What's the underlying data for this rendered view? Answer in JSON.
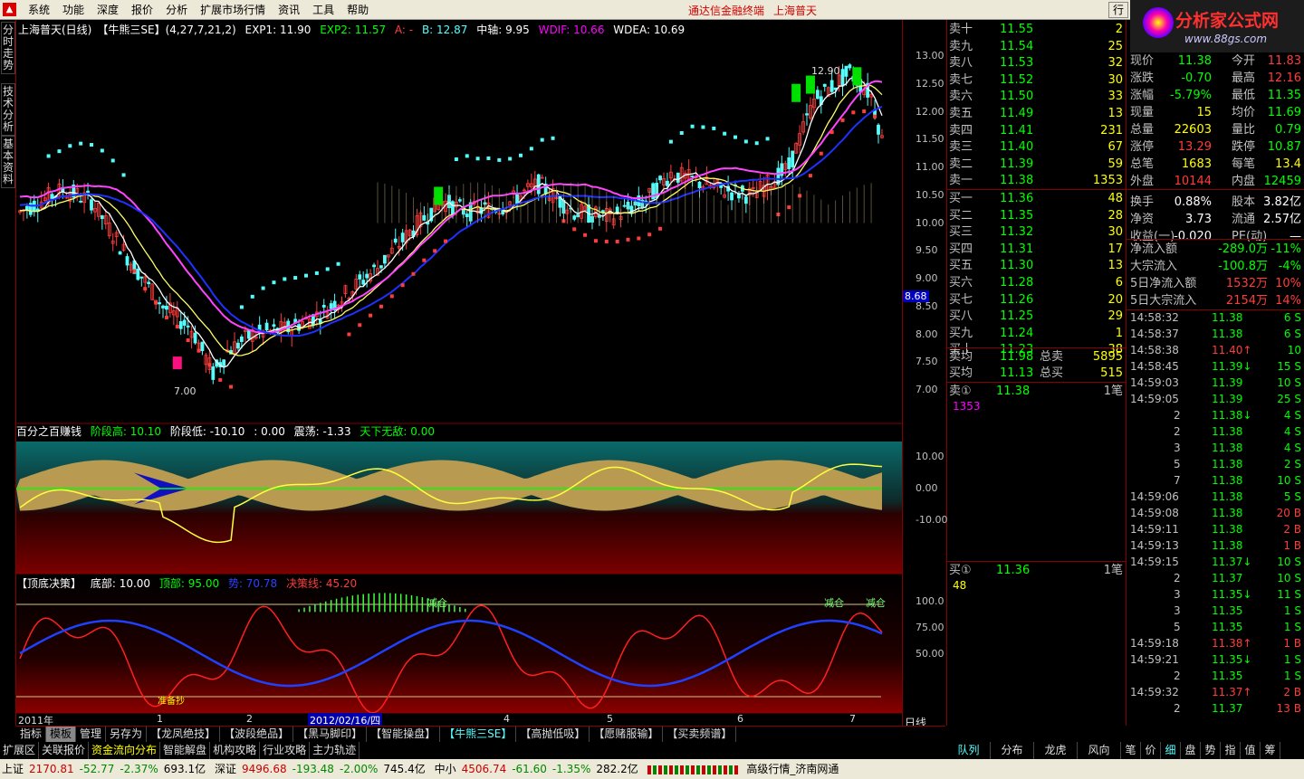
{
  "menu": {
    "items": [
      "系统",
      "功能",
      "深度",
      "报价",
      "分析",
      "扩展市场行情",
      "资讯",
      "工具",
      "帮助"
    ],
    "brand1": "通达信金融终端",
    "brand2": "上海普天",
    "win_btn": "行"
  },
  "logo": {
    "title": "分析家公式网",
    "url": "www.88gs.com",
    "code": "600680"
  },
  "left_tabs": [
    "分时走势",
    "技术分析",
    "基本资料"
  ],
  "main_header": {
    "title": "上海普天(日线)",
    "indicator": "【牛熊三SE】",
    "params": "(4,27,7,21,2)",
    "exp1": "EXP1: 11.90",
    "exp2": "EXP2: 11.57",
    "a": "A: -",
    "b": "B: 12.87",
    "zhongzhou": "中轴: 9.95",
    "wdif": "WDIF: 10.66",
    "wdea": "WDEA: 10.69"
  },
  "price_axis": [
    "13.00",
    "12.50",
    "12.00",
    "11.50",
    "11.00",
    "10.50",
    "10.00",
    "9.50",
    "9.00",
    "8.68",
    "8.50",
    "8.00",
    "7.50",
    "7.00"
  ],
  "annotations": {
    "high": "12.90",
    "low": "7.00"
  },
  "pane2": {
    "title": "百分之百赚钱",
    "high": "阶段高: 10.10",
    "low": "阶段低: -10.10",
    "zero": ": 0.00",
    "zhendang": "震荡: -1.33",
    "tianxia": "天下无敌: 0.00",
    "axis": [
      "10.00",
      "0.00",
      "-10.00"
    ]
  },
  "pane3": {
    "title": "【顶底决策】",
    "bottom": "底部: 10.00",
    "top": "顶部: 95.00",
    "b": "势: 70.78",
    "decision": "决策线: 45.20",
    "axis": [
      "100.0",
      "75.00",
      "50.00"
    ],
    "buy": "准备抄",
    "jiancang1": "减仓",
    "jiancang2": "减仓",
    "jiancang3": "减仓"
  },
  "time_axis": {
    "start": "2011年",
    "m1": "1",
    "m2": "2",
    "date": "2012/02/16/四",
    "m4": "4",
    "m5": "5",
    "m6": "6",
    "m7": "7",
    "period": "日线"
  },
  "orderbook": {
    "sells": [
      [
        "卖十",
        "11.55",
        "2"
      ],
      [
        "卖九",
        "11.54",
        "25"
      ],
      [
        "卖八",
        "11.53",
        "32"
      ],
      [
        "卖七",
        "11.52",
        "30"
      ],
      [
        "卖六",
        "11.50",
        "33"
      ],
      [
        "卖五",
        "11.49",
        "13"
      ],
      [
        "卖四",
        "11.41",
        "231"
      ],
      [
        "卖三",
        "11.40",
        "67"
      ],
      [
        "卖二",
        "11.39",
        "59"
      ],
      [
        "卖一",
        "11.38",
        "1353"
      ]
    ],
    "buys": [
      [
        "买一",
        "11.36",
        "48"
      ],
      [
        "买二",
        "11.35",
        "28"
      ],
      [
        "买三",
        "11.32",
        "30"
      ],
      [
        "买四",
        "11.31",
        "17"
      ],
      [
        "买五",
        "11.30",
        "13"
      ],
      [
        "买六",
        "11.28",
        "6"
      ],
      [
        "买七",
        "11.26",
        "20"
      ],
      [
        "买八",
        "11.25",
        "29"
      ],
      [
        "买九",
        "11.24",
        "1"
      ],
      [
        "买十",
        "11.23",
        "38"
      ]
    ],
    "avg": [
      [
        "卖均",
        "11.98",
        "总卖",
        "5895"
      ],
      [
        "买均",
        "11.13",
        "总买",
        "515"
      ]
    ],
    "sell1": {
      "label": "卖①",
      "price": "11.38",
      "vol": "1笔",
      "qty": "1353"
    },
    "buy1": {
      "label": "买①",
      "price": "11.36",
      "vol": "1笔",
      "qty": "48"
    }
  },
  "quote": [
    [
      "现价",
      "11.38",
      "今开",
      "11.83"
    ],
    [
      "涨跌",
      "-0.70",
      "最高",
      "12.16"
    ],
    [
      "涨幅",
      "-5.79%",
      "最低",
      "11.35"
    ],
    [
      "现量",
      "15",
      "均价",
      "11.69"
    ],
    [
      "总量",
      "22603",
      "量比",
      "0.79"
    ],
    [
      "涨停",
      "13.29",
      "跌停",
      "10.87"
    ],
    [
      "总笔",
      "1683",
      "每笔",
      "13.4"
    ],
    [
      "外盘",
      "10144",
      "内盘",
      "12459"
    ],
    [
      "换手",
      "0.88%",
      "股本",
      "3.82亿"
    ],
    [
      "净资",
      "3.73",
      "流通",
      "2.57亿"
    ],
    [
      "收益(一)",
      "-0.020",
      "PE(动)",
      "—"
    ]
  ],
  "flows": [
    [
      "净流入额",
      "-289.0万",
      "-11%"
    ],
    [
      "大宗流入",
      "-100.8万",
      "-4%"
    ],
    [
      "5日净流入额",
      "1532万",
      "10%"
    ],
    [
      "5日大宗流入",
      "2154万",
      "14%"
    ]
  ],
  "ticks": [
    [
      "14:58:32",
      "11.38",
      "6 S"
    ],
    [
      "14:58:37",
      "11.38",
      "6 S"
    ],
    [
      "14:58:38",
      "11.40↑",
      "10"
    ],
    [
      "14:58:45",
      "11.39↓",
      "15 S"
    ],
    [
      "14:59:03",
      "11.39",
      "10 S"
    ],
    [
      "14:59:05",
      "11.39",
      "25 S"
    ],
    [
      "2",
      "11.38↓",
      "4 S"
    ],
    [
      "2",
      "11.38",
      "4 S"
    ],
    [
      "3",
      "11.38",
      "4 S"
    ],
    [
      "5",
      "11.38",
      "2 S"
    ],
    [
      "7",
      "11.38",
      "10 S"
    ],
    [
      "14:59:06",
      "11.38",
      "5 S"
    ],
    [
      "14:59:08",
      "11.38",
      "20 B"
    ],
    [
      "14:59:11",
      "11.38",
      "2 B"
    ],
    [
      "14:59:13",
      "11.38",
      "1 B"
    ],
    [
      "14:59:15",
      "11.37↓",
      "10 S"
    ],
    [
      "2",
      "11.37",
      "10 S"
    ],
    [
      "3",
      "11.35↓",
      "11 S"
    ],
    [
      "3",
      "11.35",
      "1 S"
    ],
    [
      "5",
      "11.35",
      "1 S"
    ],
    [
      "14:59:18",
      "11.38↑",
      "1 B"
    ],
    [
      "14:59:21",
      "11.35↓",
      "1 S"
    ],
    [
      "2",
      "11.35",
      "1 S"
    ],
    [
      "14:59:32",
      "11.37↑",
      "2 B"
    ],
    [
      "2",
      "11.37",
      "13 B"
    ]
  ],
  "tabbar1": [
    "指标",
    "模板",
    "管理",
    "另存为",
    "【龙凤绝技】",
    "【波段绝品】",
    "【黑马脚印】",
    "【智能操盘】",
    "【牛熊三SE】",
    "【高抛低吸】",
    "【愿赌服输】",
    "【买卖频谱】"
  ],
  "tabbar2": [
    "扩展区",
    "关联报价",
    "资金流向分布",
    "智能解盘",
    "机构攻略",
    "行业攻略",
    "主力轨迹"
  ],
  "rtabs": [
    "队列",
    "分布",
    "龙虎",
    "风向",
    "笔",
    "价",
    "细",
    "盘",
    "势",
    "指",
    "值",
    "筹"
  ],
  "status": {
    "sh": "上证",
    "sh_v": "2170.81",
    "sh_c": "-52.77",
    "sh_p": "-2.37%",
    "sh_a": "693.1亿",
    "sz": "深证",
    "sz_v": "9496.68",
    "sz_c": "-193.48",
    "sz_p": "-2.00%",
    "sz_a": "745.4亿",
    "zx": "中小",
    "zx_v": "4506.74",
    "zx_c": "-61.60",
    "zx_p": "-1.35%",
    "zx_a": "282.2亿",
    "hq": "高级行情_济南网通"
  },
  "colors": {
    "up": "#ff3c3c",
    "down": "#54fcfc",
    "ma1": "#ffffff",
    "ma2": "#ffff66",
    "ma3": "#ff44ff",
    "ma4": "#2030ff"
  }
}
